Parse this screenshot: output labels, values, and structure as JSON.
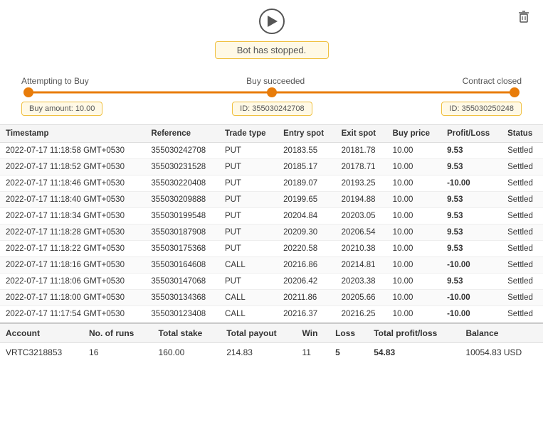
{
  "topbar": {
    "play_label": "▶",
    "trash_label": "🗑"
  },
  "status": {
    "message": "Bot has stopped."
  },
  "progress": {
    "step1": "Attempting to Buy",
    "step2": "Buy succeeded",
    "step3": "Contract closed",
    "sublabel1": "Buy amount: 10.00",
    "sublabel2": "ID: 355030242708",
    "sublabel3": "ID: 355030250248"
  },
  "table": {
    "headers": [
      "Timestamp",
      "Reference",
      "Trade type",
      "Entry spot",
      "Exit spot",
      "Buy price",
      "Profit/Loss",
      "Status"
    ],
    "rows": [
      [
        "2022-07-17 11:18:58 GMT+0530",
        "355030242708",
        "PUT",
        "20183.55",
        "20181.78",
        "10.00",
        "9.53",
        "positive",
        "Settled"
      ],
      [
        "2022-07-17 11:18:52 GMT+0530",
        "355030231528",
        "PUT",
        "20185.17",
        "20178.71",
        "10.00",
        "9.53",
        "positive",
        "Settled"
      ],
      [
        "2022-07-17 11:18:46 GMT+0530",
        "355030220408",
        "PUT",
        "20189.07",
        "20193.25",
        "10.00",
        "-10.00",
        "negative",
        "Settled"
      ],
      [
        "2022-07-17 11:18:40 GMT+0530",
        "355030209888",
        "PUT",
        "20199.65",
        "20194.88",
        "10.00",
        "9.53",
        "positive",
        "Settled"
      ],
      [
        "2022-07-17 11:18:34 GMT+0530",
        "355030199548",
        "PUT",
        "20204.84",
        "20203.05",
        "10.00",
        "9.53",
        "positive",
        "Settled"
      ],
      [
        "2022-07-17 11:18:28 GMT+0530",
        "355030187908",
        "PUT",
        "20209.30",
        "20206.54",
        "10.00",
        "9.53",
        "positive",
        "Settled"
      ],
      [
        "2022-07-17 11:18:22 GMT+0530",
        "355030175368",
        "PUT",
        "20220.58",
        "20210.38",
        "10.00",
        "9.53",
        "positive",
        "Settled"
      ],
      [
        "2022-07-17 11:18:16 GMT+0530",
        "355030164608",
        "CALL",
        "20216.86",
        "20214.81",
        "10.00",
        "-10.00",
        "negative",
        "Settled"
      ],
      [
        "2022-07-17 11:18:06 GMT+0530",
        "355030147068",
        "PUT",
        "20206.42",
        "20203.38",
        "10.00",
        "9.53",
        "positive",
        "Settled"
      ],
      [
        "2022-07-17 11:18:00 GMT+0530",
        "355030134368",
        "CALL",
        "20211.86",
        "20205.66",
        "10.00",
        "-10.00",
        "negative",
        "Settled"
      ],
      [
        "2022-07-17 11:17:54 GMT+0530",
        "355030123408",
        "CALL",
        "20216.37",
        "20216.25",
        "10.00",
        "-10.00",
        "negative",
        "Settled"
      ]
    ]
  },
  "footer": {
    "headers": [
      "Account",
      "No. of runs",
      "Total stake",
      "Total payout",
      "Win",
      "Loss",
      "Total profit/loss",
      "Balance"
    ],
    "row": {
      "account": "VRTC3218853",
      "runs": "16",
      "total_stake": "160.00",
      "total_payout": "214.83",
      "win": "11",
      "loss": "5",
      "total_profit": "54.83",
      "balance": "10054.83 USD"
    }
  }
}
